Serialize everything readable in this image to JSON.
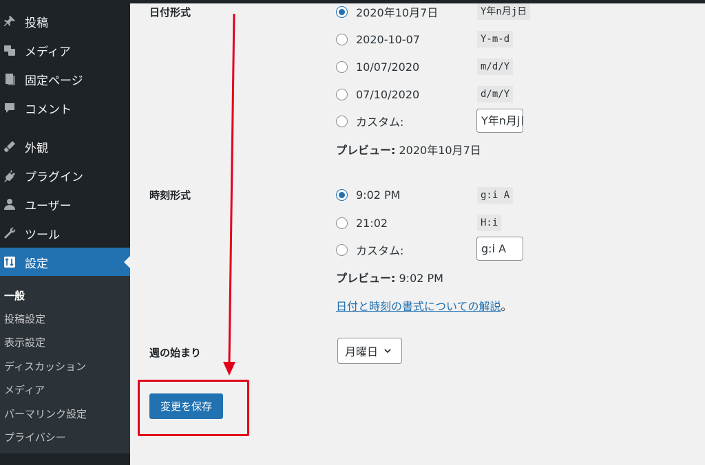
{
  "sidebar": {
    "menu": [
      {
        "label": "投稿",
        "icon": "pin-icon"
      },
      {
        "label": "メディア",
        "icon": "media-icon"
      },
      {
        "label": "固定ページ",
        "icon": "page-icon"
      },
      {
        "label": "コメント",
        "icon": "comment-icon"
      },
      {
        "label": "外観",
        "icon": "brush-icon"
      },
      {
        "label": "プラグイン",
        "icon": "plugin-icon"
      },
      {
        "label": "ユーザー",
        "icon": "user-icon"
      },
      {
        "label": "ツール",
        "icon": "wrench-icon"
      },
      {
        "label": "設定",
        "icon": "settings-icon"
      }
    ],
    "submenu": [
      "一般",
      "投稿設定",
      "表示設定",
      "ディスカッション",
      "メディア",
      "パーマリンク設定",
      "プライバシー"
    ]
  },
  "date_format": {
    "label": "日付形式",
    "options": [
      {
        "label": "2020年10月7日",
        "code": "Y年n月j日",
        "checked": true
      },
      {
        "label": "2020-10-07",
        "code": "Y-m-d",
        "checked": false
      },
      {
        "label": "10/07/2020",
        "code": "m/d/Y",
        "checked": false
      },
      {
        "label": "07/10/2020",
        "code": "d/m/Y",
        "checked": false
      }
    ],
    "custom_label": "カスタム:",
    "custom_value": "Y年n月j日",
    "preview_label": "プレビュー:",
    "preview_value": "2020年10月7日"
  },
  "time_format": {
    "label": "時刻形式",
    "options": [
      {
        "label": "9:02 PM",
        "code": "g:i A",
        "checked": true
      },
      {
        "label": "21:02",
        "code": "H:i",
        "checked": false
      }
    ],
    "custom_label": "カスタム:",
    "custom_value": "g:i A",
    "preview_label": "プレビュー:",
    "preview_value": "9:02 PM"
  },
  "doc_link": {
    "text": "日付と時刻の書式についての解説",
    "suffix": "。"
  },
  "week_start": {
    "label": "週の始まり",
    "value": "月曜日"
  },
  "save_button": "変更を保存",
  "colors": {
    "accent": "#2271b1",
    "sidebar": "#1d2327",
    "annotation": "#e3001b"
  }
}
